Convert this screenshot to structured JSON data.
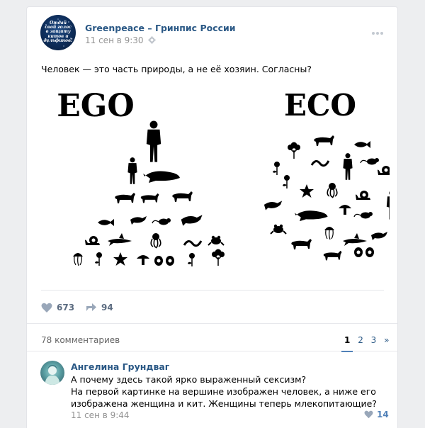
{
  "post": {
    "author": "Greenpeace – Гринпис России",
    "avatar_text": "Отдай\nсвой голос\nв защиту\nкитов и\nдельфинов!",
    "date": "11 сен в 9:30",
    "text": "Человек — это часть природы, а не её хозяин. Согласны?",
    "image": {
      "left_title": "EGO",
      "right_title": "ECO"
    },
    "likes": "673",
    "shares": "94"
  },
  "comments_section": {
    "count_label": "78 комментариев",
    "pages": [
      "1",
      "2",
      "3",
      "»"
    ],
    "current_page": "1"
  },
  "comment": {
    "author": "Ангелина Грундваг",
    "lines": [
      "А почему здесь такой ярко выраженный сексизм?",
      "На первой картинке на вершине изображен человек, а ниже его",
      "изображена женщина и кит. Женщины теперь млекопитающие?"
    ],
    "date": "11 сен в 9:44",
    "likes": "14"
  },
  "colors": {
    "link": "#2a5885",
    "muted": "#939393",
    "action": "#5b6b80",
    "accent": "#5181b8",
    "background": "#edeef0"
  },
  "icons": [
    "more-icon",
    "gear-icon",
    "heart-icon",
    "share-icon"
  ]
}
